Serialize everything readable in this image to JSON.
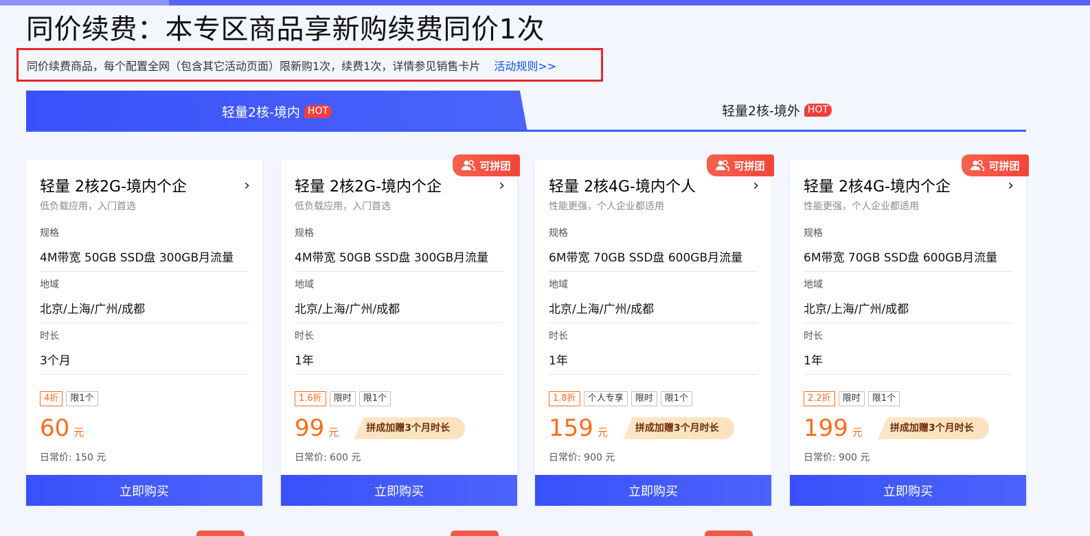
{
  "page": {
    "title": "同价续费：本专区商品享新购续费同价1次",
    "notice_text": "同价续费商品，每个配置全网（包含其它活动页面）限新购1次，续费1次，详情参见销售卡片",
    "rule_link": "活动规则>>"
  },
  "tabs": [
    {
      "label": "轻量2核-境内",
      "badge": "HOT",
      "active": true
    },
    {
      "label": "轻量2核-境外",
      "badge": "HOT",
      "active": false
    }
  ],
  "labels": {
    "spec": "规格",
    "region": "地域",
    "duration": "时长",
    "buy": "立即购买",
    "group_badge": "可拼团"
  },
  "cards": [
    {
      "title": "轻量 2核2G-境内个企",
      "subtitle": "低负载应用，入门首选",
      "spec": "4M带宽 50GB SSD盘 300GB月流量",
      "region": "北京/上海/广州/成都",
      "duration": "3个月",
      "discount": "4折",
      "tags": [
        "限1个"
      ],
      "price": "60",
      "unit": "元",
      "promo": "",
      "regular": "日常价: 150 元",
      "group": false
    },
    {
      "title": "轻量 2核2G-境内个企",
      "subtitle": "低负载应用，入门首选",
      "spec": "4M带宽 50GB SSD盘 300GB月流量",
      "region": "北京/上海/广州/成都",
      "duration": "1年",
      "discount": "1.6折",
      "tags": [
        "限时",
        "限1个"
      ],
      "price": "99",
      "unit": "元",
      "promo": "拼成加赠3个月时长",
      "regular": "日常价: 600 元",
      "group": true
    },
    {
      "title": "轻量 2核4G-境内个人",
      "subtitle": "性能更强，个人企业都适用",
      "spec": "6M带宽 70GB SSD盘 600GB月流量",
      "region": "北京/上海/广州/成都",
      "duration": "1年",
      "discount": "1.8折",
      "tags": [
        "个人专享",
        "限时",
        "限1个"
      ],
      "price": "159",
      "unit": "元",
      "promo": "拼成加赠3个月时长",
      "regular": "日常价: 900 元",
      "group": true
    },
    {
      "title": "轻量 2核4G-境内个企",
      "subtitle": "性能更强，个人企业都适用",
      "spec": "6M带宽 70GB SSD盘 600GB月流量",
      "region": "北京/上海/广州/成都",
      "duration": "1年",
      "discount": "2.2折",
      "tags": [
        "限时",
        "限1个"
      ],
      "price": "199",
      "unit": "元",
      "promo": "拼成加赠3个月时长",
      "regular": "日常价: 900 元",
      "group": true
    }
  ],
  "colors": {
    "accent": "#3b5bfb",
    "price": "#ff6a1a",
    "hot": "#f23e3e",
    "notice_border": "#e8262a"
  }
}
